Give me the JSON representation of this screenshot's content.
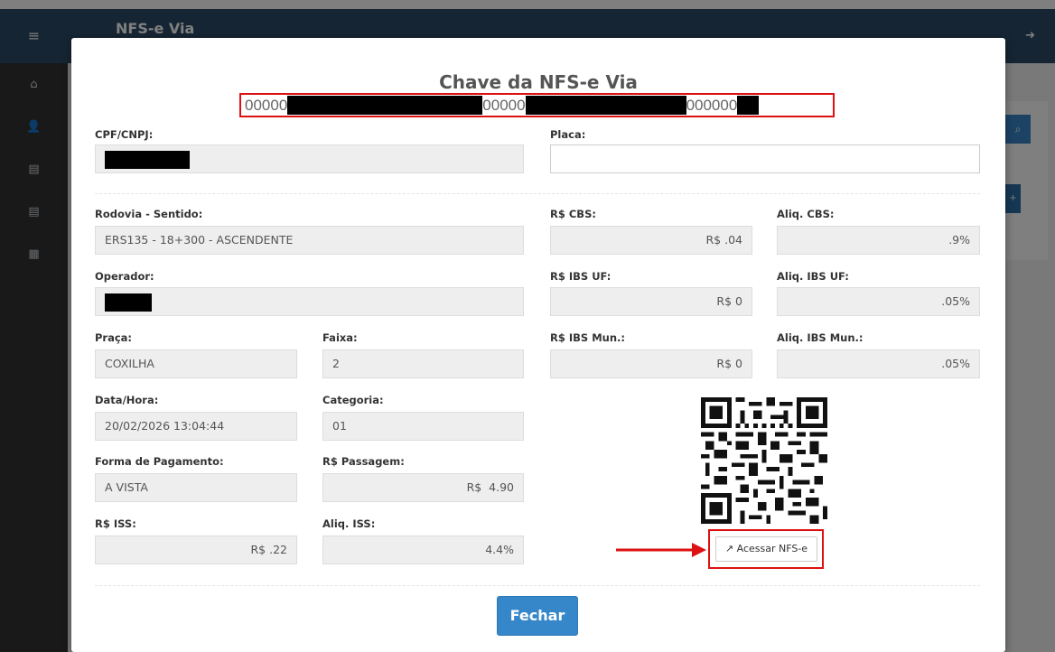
{
  "app": {
    "title": "NFS-e Via",
    "menu_icon": "menu-icon",
    "logout_icon": "logout-icon"
  },
  "sidebar": {
    "items": [
      {
        "icon": "home-icon",
        "glyph": "⌂"
      },
      {
        "icon": "user-icon",
        "glyph": "👤"
      },
      {
        "icon": "document-icon",
        "glyph": "▤"
      },
      {
        "icon": "document-icon",
        "glyph": "▤"
      },
      {
        "icon": "list-icon",
        "glyph": "▦"
      }
    ]
  },
  "modal": {
    "title": "Chave da NFS-e Via",
    "key_parts": [
      "00000",
      "00000",
      "000000"
    ],
    "fields": {
      "cpf_label": "CPF/CNPJ:",
      "placa_label": "Placa:",
      "placa_value": "",
      "rodovia_label": "Rodovia - Sentido:",
      "rodovia_value": "ERS135 - 18+300 - ASCENDENTE",
      "operador_label": "Operador:",
      "praca_label": "Praça:",
      "praca_value": "COXILHA",
      "faixa_label": "Faixa:",
      "faixa_value": "2",
      "datahora_label": "Data/Hora:",
      "datahora_value": "20/02/2026 13:04:44",
      "categoria_label": "Categoria:",
      "categoria_value": "01",
      "forma_label": "Forma de Pagamento:",
      "forma_value": "A VISTA",
      "passagem_label": "R$ Passagem:",
      "passagem_value": "R$  4.90",
      "iss_label": "R$ ISS:",
      "iss_value": "R$ .22",
      "aliq_iss_label": "Aliq. ISS:",
      "aliq_iss_value": "4.4%",
      "cbs_label": "R$ CBS:",
      "cbs_value": "R$ .04",
      "aliq_cbs_label": "Aliq. CBS:",
      "aliq_cbs_value": ".9%",
      "ibs_uf_label": "R$ IBS UF:",
      "ibs_uf_value": "R$ 0",
      "aliq_ibs_uf_label": "Aliq. IBS UF:",
      "aliq_ibs_uf_value": ".05%",
      "ibs_mun_label": "R$ IBS Mun.:",
      "ibs_mun_value": "R$ 0",
      "aliq_ibs_mun_label": "Aliq. IBS Mun.:",
      "aliq_ibs_mun_value": ".05%"
    },
    "qr_button_label": "Acessar NFS-e",
    "close_label": "Fechar",
    "accent_color": "#3587c9",
    "highlight_color": "#dd1111"
  }
}
